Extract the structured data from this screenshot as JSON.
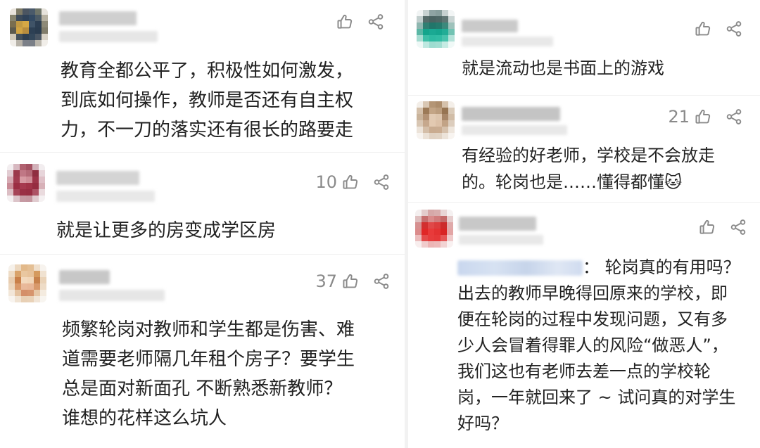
{
  "left_column": [
    {
      "likes": "",
      "text_lines": [
        "教育全都公平了，积极性如何激发，",
        "到底如何操作，教师是否还有自主权",
        "力，不一刀的落实还有很长的路要走"
      ]
    },
    {
      "likes": "10",
      "text_lines": [
        "就是让更多的房变成学区房"
      ]
    },
    {
      "likes": "37",
      "text_lines": [
        "频繁轮岗对教师和学生都是伤害、难",
        "道需要老师隔几年租个房子？要学生",
        "总是面对新面孔 不断熟悉新教师？",
        "谁想的花样这么坑人"
      ]
    }
  ],
  "right_column": [
    {
      "likes": "",
      "text_lines": [
        "就是流动也是书面上的游戏"
      ]
    },
    {
      "likes": "21",
      "text_lines": [
        "有经验的好老师，学校是不会放走",
        "的。轮岗也是……懂得都懂🐱"
      ]
    },
    {
      "likes": "",
      "mention_suffix": "：  轮岗真的有用吗？",
      "text_lines": [
        "出去的教师早晚得回原来的学校，即",
        "便在轮岗的过程中发现问题，又有多",
        "少人会冒着得罪人的风险“做恶人”，",
        "我们这也有老师去差一点的学校轮",
        "岗，一年就回来了 ~ 试问真的对学生",
        "好吗？"
      ]
    }
  ],
  "icons": [
    "thumbs-up-icon",
    "share-icon"
  ],
  "colors": {
    "meta_gray": "#8a8a8a",
    "text": "#222222",
    "divider": "#efefef",
    "mention": "#c9d7ee"
  }
}
